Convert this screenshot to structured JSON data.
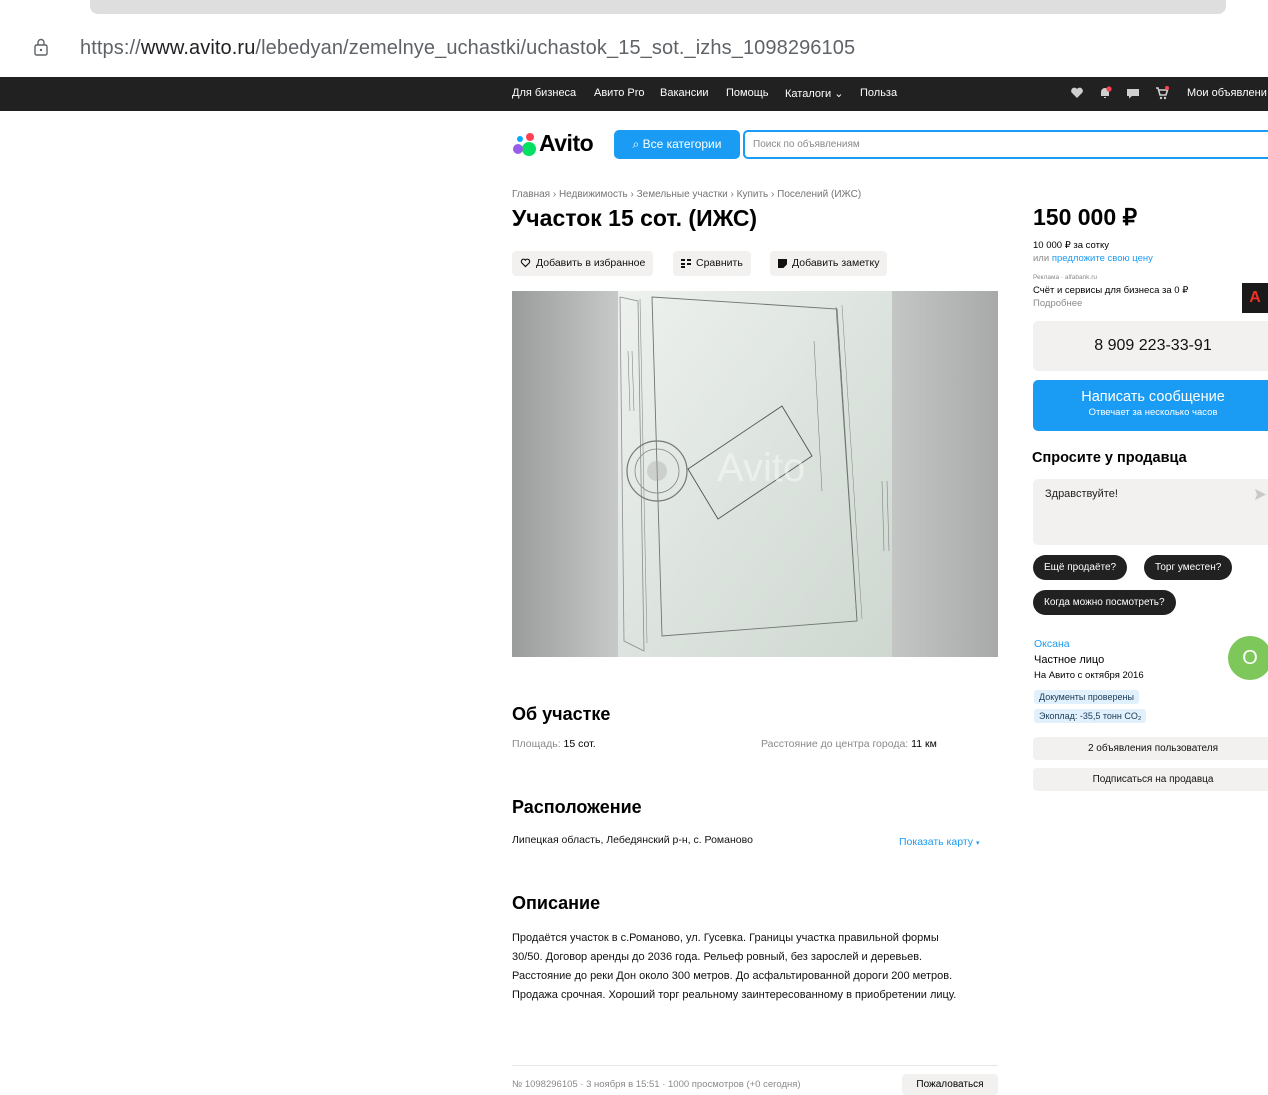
{
  "browser": {
    "url_prefix": "https://",
    "url_domain": "www.avito.ru",
    "url_path": "/lebedyan/zemelnye_uchastki/uchastok_15_sot._izhs_1098296105"
  },
  "topbar": {
    "links": [
      "Для бизнеса",
      "Авито Pro",
      "Вакансии",
      "Помощь",
      "Каталоги",
      "Польза"
    ],
    "my_ads": "Мои объявлени"
  },
  "header": {
    "logo": "Avito",
    "all_categories": "Все категории",
    "search_placeholder": "Поиск по объявлениям"
  },
  "breadcrumbs": "Главная › Недвижимость › Земельные участки › Купить › Поселений (ИЖС)",
  "listing": {
    "title": "Участок 15 сот. (ИЖС)",
    "actions": {
      "favorite": "Добавить в избранное",
      "compare": "Сравнить",
      "note": "Добавить заметку"
    },
    "photo_watermark": "Avito",
    "about": {
      "heading": "Об участке",
      "area_label": "Площадь:",
      "area_value": "15 сот.",
      "distance_label": "Расстояние до центра города:",
      "distance_value": "11 км"
    },
    "location": {
      "heading": "Расположение",
      "address": "Липецкая область, Лебедянский р-н, с. Романово",
      "show_map": "Показать карту"
    },
    "description": {
      "heading": "Описание",
      "text": "Продаётся участок в с.Романово, ул. Гусевка. Границы участка правильной формы 30/50. Договор аренды до 2036 года. Рельеф ровный, без зарослей и деревьев. Расстояние до реки Дон около 300 метров. До асфальтированной дороги 200 метров. Продажа срочная. Хороший торг реальному заинтересованному в приобретении лицу."
    },
    "footer": {
      "meta": "№ 1098296105 · 3 ноября в 15:51 · 1000 просмотров (+0 сегодня)",
      "complain": "Пожаловаться"
    }
  },
  "sidebar": {
    "price": "150 000 ₽",
    "per_sotka": "10 000 ₽ за сотку",
    "offer_prefix": "или",
    "offer_link": "предложите свою цену",
    "ad_label": "Реклама · alfabank.ru",
    "ad_title": "Счёт и сервисы для бизнеса за 0 ₽",
    "ad_more": "Подробнее",
    "ad_icon": "А",
    "phone": "8 909 223-33-91",
    "message_title": "Написать сообщение",
    "message_sub": "Отвечает за несколько часов",
    "ask_heading": "Спросите у продавца",
    "ask_text": "Здравствуйте!",
    "quick_replies": [
      "Ещё продаёте?",
      "Торг уместен?",
      "Когда можно посмотреть?"
    ],
    "seller": {
      "name": "Оксана",
      "type": "Частное лицо",
      "since": "На Авито с октября 2016",
      "badges": [
        "Документы проверены",
        "Экоплад: -35,5 тонн CO₂"
      ],
      "avatar_letter": "О",
      "ads_count": "2 объявления пользователя",
      "subscribe": "Подписаться на продавца"
    }
  },
  "colors": {
    "accent": "#1a9bf4",
    "topbar": "#212121",
    "pill_bg": "#f2f1f0",
    "avatar": "#7ec75a"
  }
}
